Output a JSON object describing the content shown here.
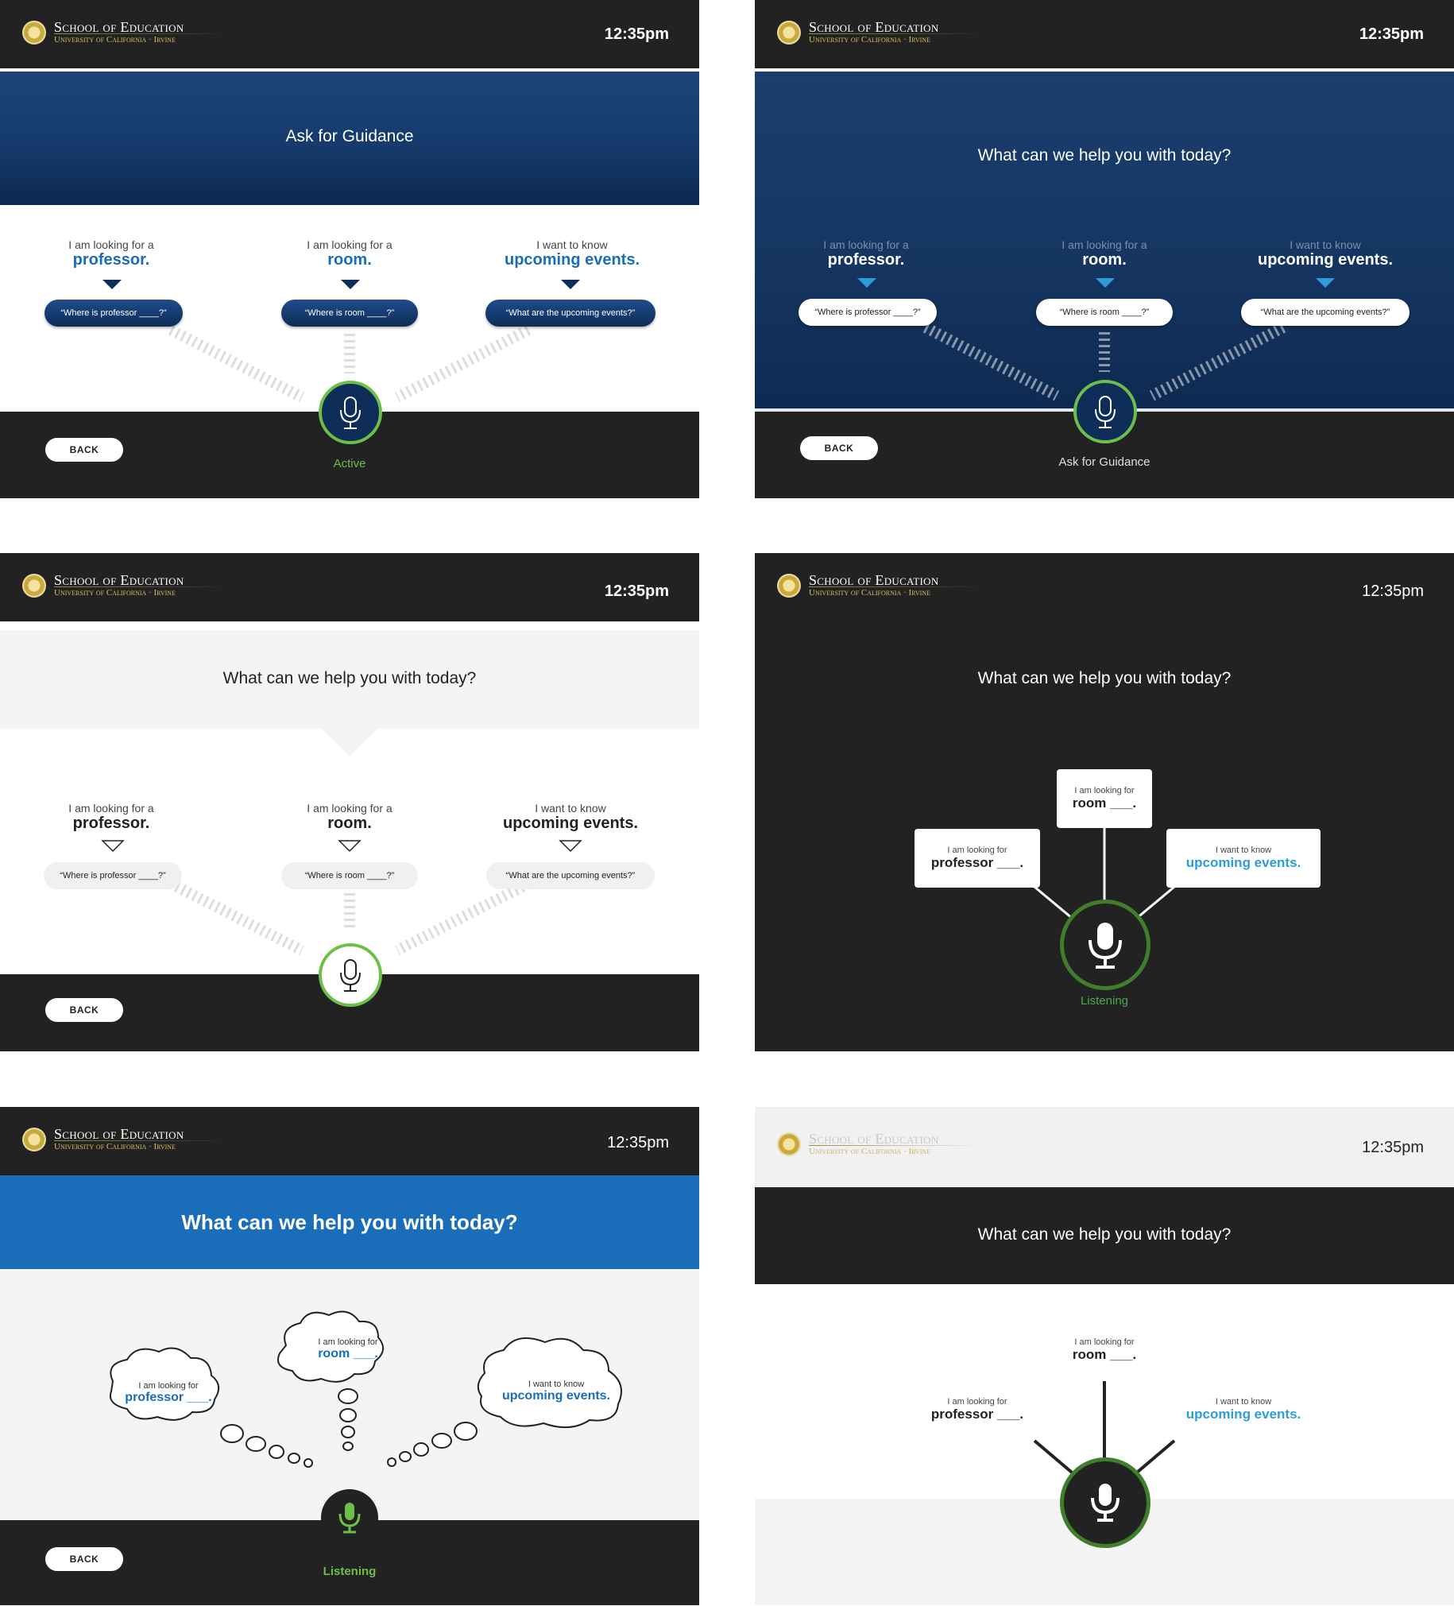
{
  "logo": {
    "line1": "School of Education",
    "line2": "University of California · Irvine"
  },
  "time": "12:35pm",
  "back": "BACK",
  "options": {
    "professor": {
      "pre": "I am looking for a",
      "main": "professor.",
      "query": "“Where is professor ____?”"
    },
    "room": {
      "pre": "I am looking for a",
      "main": "room.",
      "query": "“Where is room ____?”"
    },
    "events": {
      "pre": "I want to know",
      "main": "upcoming events.",
      "query": "“What are the upcoming events?”"
    }
  },
  "short_options": {
    "professor": {
      "pre": "I am looking for",
      "main": "professor ___."
    },
    "room": {
      "pre": "I am looking for",
      "main": "room ___."
    },
    "events": {
      "pre": "I want to know",
      "main": "upcoming events."
    }
  },
  "screen1": {
    "title": "Ask for Guidance",
    "status": "Active"
  },
  "screen2": {
    "title": "What can we help you with today?",
    "status": "Ask for Guidance"
  },
  "screen3": {
    "title": "What can we help you with today?"
  },
  "screen4": {
    "title": "What can we help you with today?",
    "status": "Listening"
  },
  "screen5": {
    "title": "What can we help you with today?",
    "status": "Listening"
  },
  "screen6": {
    "title": "What can we help you with today?"
  },
  "colors": {
    "navy": "#0e2d58",
    "blue": "#1a6db8",
    "bright_blue": "#2d9cdb",
    "green": "#6cbf4b",
    "dark": "#222222",
    "light": "#f4f4f4"
  },
  "icons": [
    "microphone-icon",
    "university-seal-icon",
    "triangle-down-icon"
  ]
}
